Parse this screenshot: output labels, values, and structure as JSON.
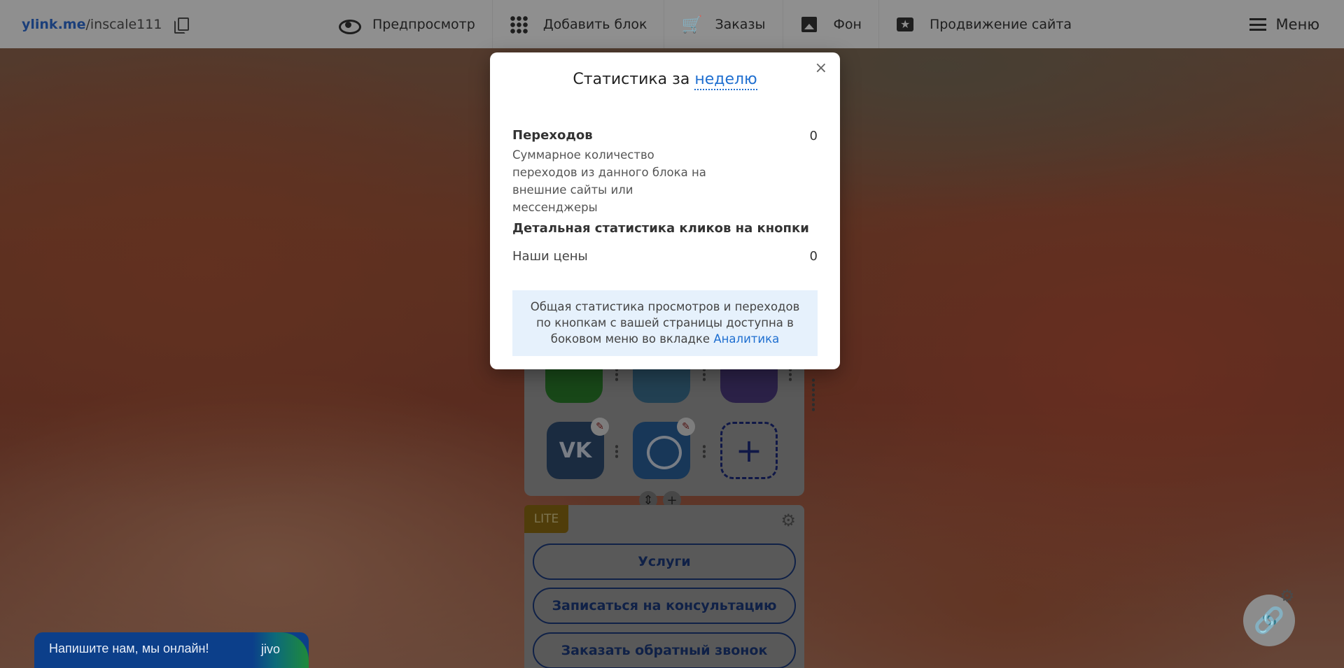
{
  "brand": {
    "host": "ylink.me",
    "path": "/inscale111"
  },
  "nav": [
    {
      "label": "Предпросмотр",
      "icon": "eye-icon"
    },
    {
      "label": "Добавить блок",
      "icon": "grid-icon"
    },
    {
      "label": "Заказы",
      "icon": "cart-icon"
    },
    {
      "label": "Фон",
      "icon": "image-icon"
    },
    {
      "label": "Продвижение сайта",
      "icon": "star-icon"
    }
  ],
  "menu": {
    "label": "Меню"
  },
  "modal": {
    "title_prefix": "Статистика за",
    "period": "неделю",
    "close": "×",
    "clicks_label": "Переходов",
    "clicks_value": "0",
    "clicks_desc": "Суммарное количество переходов из данного блока на внешние сайты или мессенджеры",
    "detail_title": "Детальная статистика кликов на кнопки",
    "detail_label": "Наши цены",
    "detail_value": "0",
    "info_text": "Общая статистика просмотров и переходов по кнопкам с вашей страницы доступна в боковом меню во вкладке",
    "info_link": "Аналитика"
  },
  "social": {
    "vk": "VK",
    "add": "+"
  },
  "block": {
    "badge": "LITE",
    "buttons": [
      "Услуги",
      "Записаться на консультацию",
      "Заказать обратный звонок"
    ]
  },
  "chat": {
    "text": "Напишите нам, мы онлайн!",
    "logo": "jivo"
  },
  "colors": {
    "accent": "#1f6fd0",
    "info_bg": "#e6f1fc",
    "chat_bg": "#0c3f8a"
  }
}
